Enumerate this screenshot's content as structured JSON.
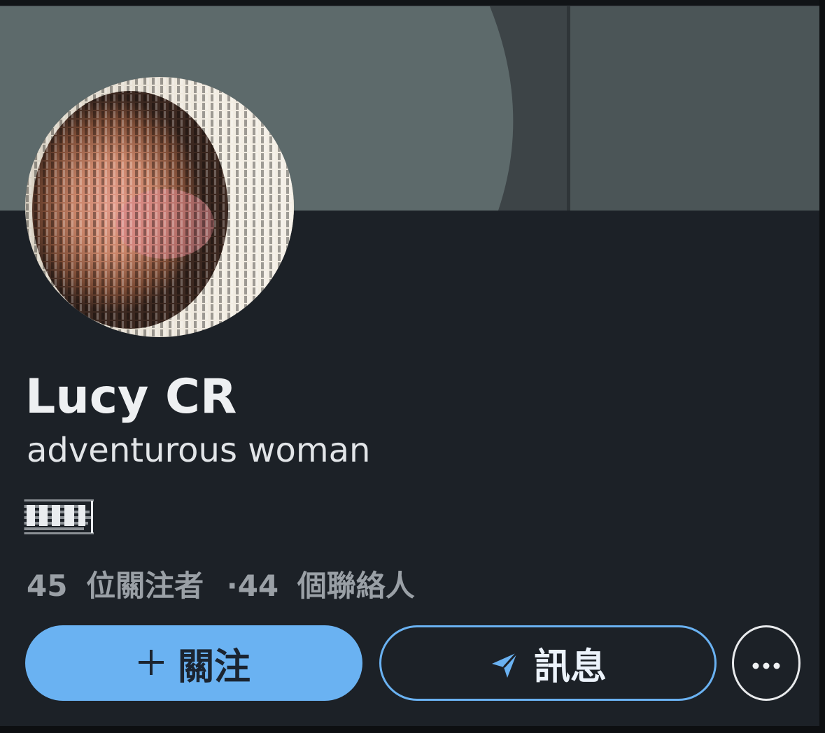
{
  "profile": {
    "name": "Lucy CR",
    "bio": "adventurous woman",
    "stats": {
      "followers_count": "45",
      "followers_label": "位關注者",
      "separator": "·",
      "contacts_count": "44",
      "contacts_label": "個聯絡人"
    }
  },
  "actions": {
    "follow_label": "關注",
    "follow_icon": "plus-icon",
    "message_label": "訊息",
    "message_icon": "send-icon",
    "more_icon": "more-icon",
    "more_glyph": "•••"
  },
  "colors": {
    "background": "#1c2127",
    "accent": "#6ab2f2",
    "name_text": "#eef0f2",
    "stats_text": "#9aa0a6"
  }
}
